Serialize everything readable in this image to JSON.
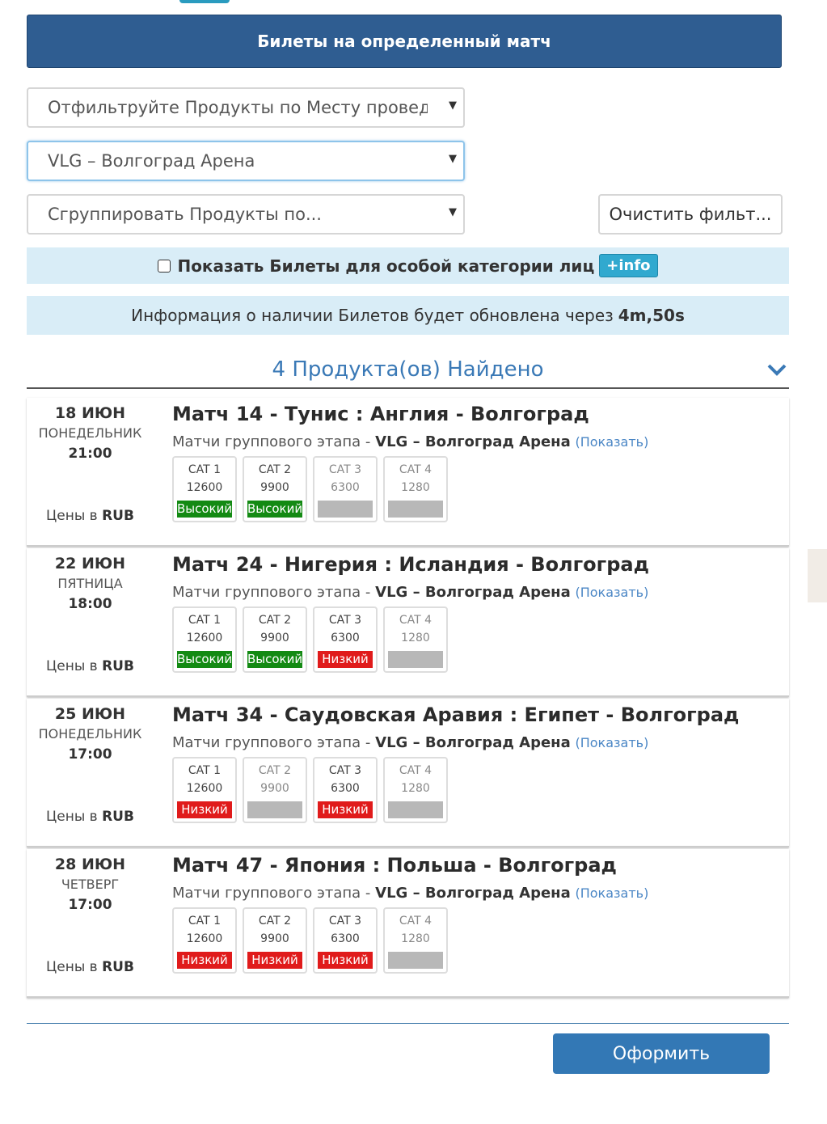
{
  "header": {
    "title": "Билеты на определенный матч"
  },
  "filters": {
    "venue_filter": "Отфильтруйте Продукты по Месту проведения",
    "venue_selected": "VLG – Волгоград Арена",
    "group_by": "Сгруппировать Продукты по...",
    "clear_label": "Очистить фильт..."
  },
  "special": {
    "label": "Показать Билеты для особой категории лиц",
    "info_label": "+info"
  },
  "refresh": {
    "text": "Информация о наличии Билетов будет обновлена через",
    "time": "4m,50s"
  },
  "results": {
    "found_text": "4 Продукта(ов) Найдено"
  },
  "common": {
    "stage": "Матчи группового этапа -",
    "venue": "VLG – Волгоград Арена",
    "show_label": "(Показать)",
    "prices_prefix": "Цены в",
    "currency": "RUB"
  },
  "matches": [
    {
      "date": "18 ИЮН",
      "day": "ПОНЕДЕЛЬНИК",
      "time": "21:00",
      "title": "Матч 14 - Тунис : Англия - Волгоград",
      "cats": [
        {
          "name": "CAT 1",
          "price": "12600",
          "status": "Высокий",
          "level": "high"
        },
        {
          "name": "CAT 2",
          "price": "9900",
          "status": "Высокий",
          "level": "high"
        },
        {
          "name": "CAT 3",
          "price": "6300",
          "status": "",
          "level": "none"
        },
        {
          "name": "CAT 4",
          "price": "1280",
          "status": "",
          "level": "none"
        }
      ]
    },
    {
      "date": "22 ИЮН",
      "day": "ПЯТНИЦА",
      "time": "18:00",
      "title": "Матч 24 - Нигерия : Исландия - Волгоград",
      "cats": [
        {
          "name": "CAT 1",
          "price": "12600",
          "status": "Высокий",
          "level": "high"
        },
        {
          "name": "CAT 2",
          "price": "9900",
          "status": "Высокий",
          "level": "high"
        },
        {
          "name": "CAT 3",
          "price": "6300",
          "status": "Низкий",
          "level": "low"
        },
        {
          "name": "CAT 4",
          "price": "1280",
          "status": "",
          "level": "none"
        }
      ]
    },
    {
      "date": "25 ИЮН",
      "day": "ПОНЕДЕЛЬНИК",
      "time": "17:00",
      "title": "Матч 34 - Саудовская Аравия : Египет - Волгоград",
      "cats": [
        {
          "name": "CAT 1",
          "price": "12600",
          "status": "Низкий",
          "level": "low"
        },
        {
          "name": "CAT 2",
          "price": "9900",
          "status": "",
          "level": "none"
        },
        {
          "name": "CAT 3",
          "price": "6300",
          "status": "Низкий",
          "level": "low"
        },
        {
          "name": "CAT 4",
          "price": "1280",
          "status": "",
          "level": "none"
        }
      ]
    },
    {
      "date": "28 ИЮН",
      "day": "ЧЕТВЕРГ",
      "time": "17:00",
      "title": "Матч 47 - Япония : Польша - Волгоград",
      "cats": [
        {
          "name": "CAT 1",
          "price": "12600",
          "status": "Низкий",
          "level": "low"
        },
        {
          "name": "CAT 2",
          "price": "9900",
          "status": "Низкий",
          "level": "low"
        },
        {
          "name": "CAT 3",
          "price": "6300",
          "status": "Низкий",
          "level": "low"
        },
        {
          "name": "CAT 4",
          "price": "1280",
          "status": "",
          "level": "none"
        }
      ]
    }
  ],
  "checkout": {
    "label": "Оформить"
  },
  "colors": {
    "header_bg": "#2f5d91",
    "info_band": "#d9edf7",
    "status_high": "#138a13",
    "status_low": "#e01b1b",
    "status_none": "#b8b8b8",
    "primary_button": "#3378b5"
  }
}
